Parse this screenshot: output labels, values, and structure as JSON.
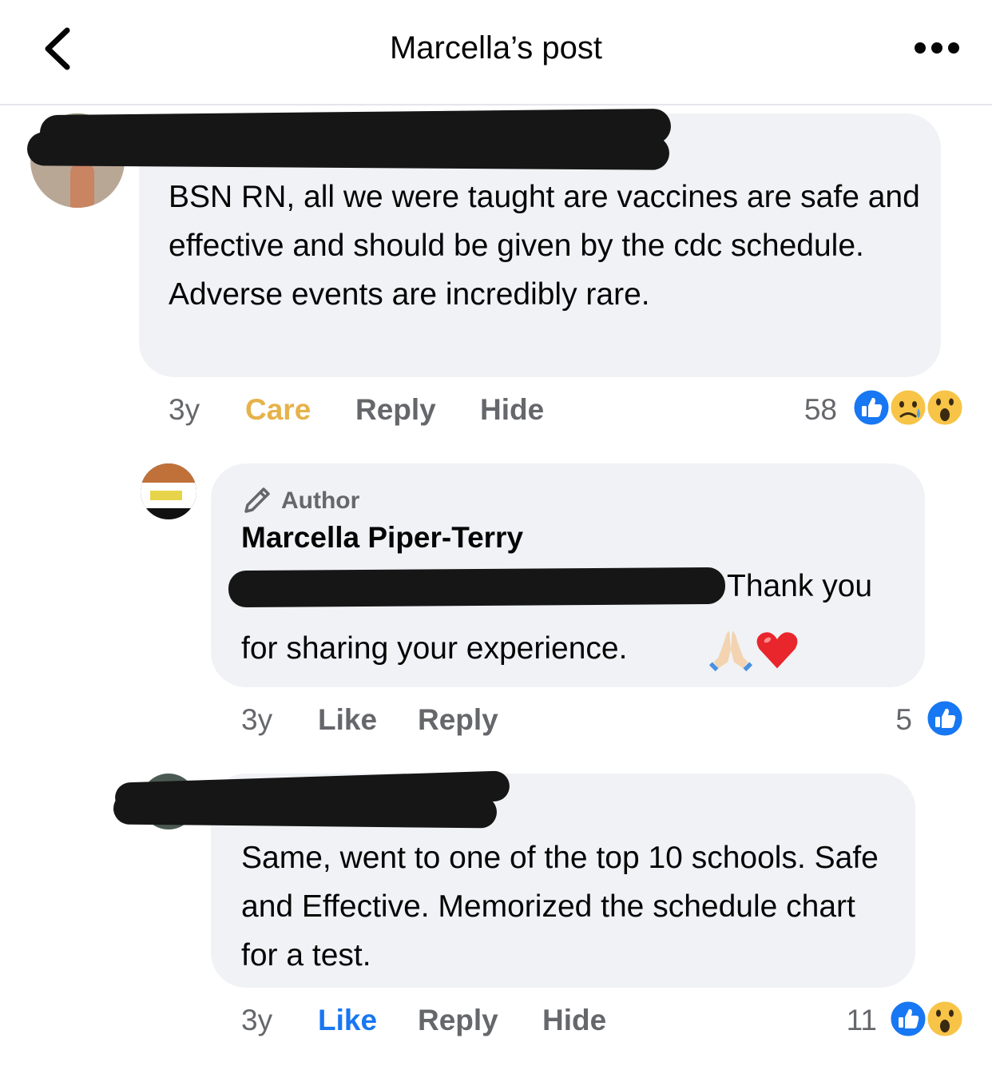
{
  "header": {
    "title": "Marcella’s post",
    "back_icon": "chevron-left-icon",
    "more_icon": "more-dots-icon"
  },
  "comments": [
    {
      "text": "BSN RN, all we were taught are vaccines are safe and effective and should be given by the cdc schedule. Adverse events are incredibly rare.",
      "time": "3y",
      "action_1": "Care",
      "action_2": "Reply",
      "action_3": "Hide",
      "reaction_count": "58",
      "reactions": [
        "like-reaction-icon",
        "care-reaction-icon",
        "wow-reaction-icon"
      ]
    },
    {
      "badge_icon": "pencil-icon",
      "badge_label": "Author",
      "author": "Marcella Piper-Terry",
      "text_line_1": "Thank you",
      "text_line_2": "for sharing your experience.",
      "emoji": [
        "folded-hands-emoji",
        "red-heart-emoji"
      ],
      "time": "3y",
      "action_1": "Like",
      "action_2": "Reply",
      "reaction_count": "5",
      "reactions": [
        "like-reaction-icon"
      ]
    },
    {
      "text": "Same, went to one of the top 10 schools. Safe and Effective. Memorized the schedule chart for a test.",
      "time": "3y",
      "action_1": "Like",
      "action_2": "Reply",
      "action_3": "Hide",
      "reaction_count": "11",
      "reactions": [
        "like-reaction-icon",
        "wow-reaction-icon"
      ]
    }
  ],
  "colors": {
    "bubble": "#f0f2f5",
    "meta_text": "#65676b",
    "like_blue": "#1877f2",
    "care_yellow": "#e6b24a",
    "redaction": "#161616"
  }
}
